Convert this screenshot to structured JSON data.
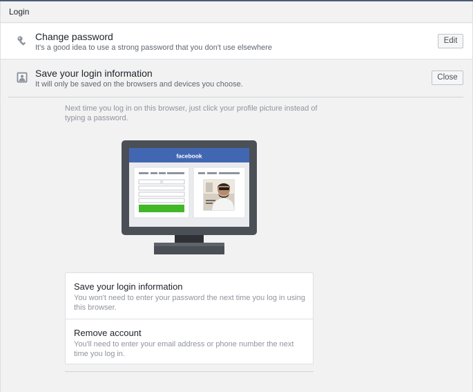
{
  "header": {
    "title": "Login"
  },
  "change_password": {
    "title": "Change password",
    "subtitle": "It's a good idea to use a strong password that you don't use elsewhere",
    "button": "Edit",
    "icon": "key-icon"
  },
  "save_login": {
    "title": "Save your login information",
    "subtitle": "It will only be saved on the browsers and devices you choose.",
    "button": "Close",
    "icon": "profile-card-icon",
    "hint": "Next time you log in on this browser, just click your profile picture instead of typing a password.",
    "illustration": {
      "brand": "facebook",
      "brand_color": "#4267b2"
    }
  },
  "options": [
    {
      "title": "Save your login information",
      "subtitle": "You won't need to enter your password the next time you log in using this browser."
    },
    {
      "title": "Remove account",
      "subtitle": "You'll need to enter your email address or phone number the next time you log in."
    }
  ]
}
